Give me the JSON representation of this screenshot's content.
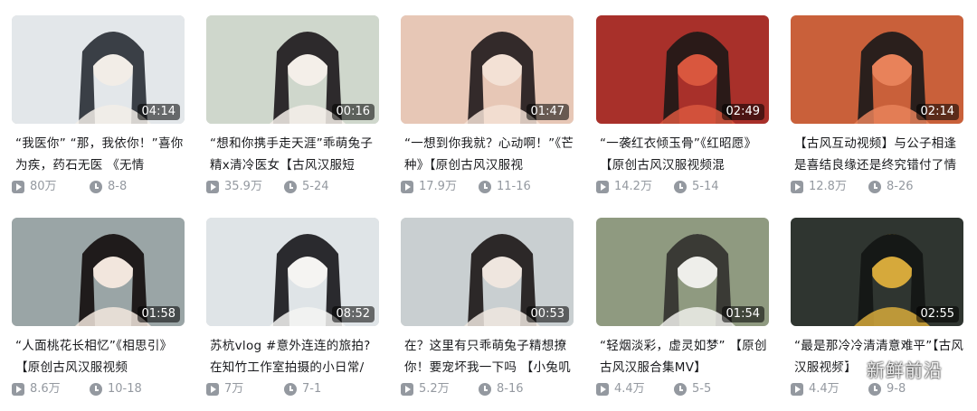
{
  "videos": [
    {
      "title": "“我医你” “那，我依你！”喜你为疾，药石无医 《无情",
      "duration": "04:14",
      "views": "80万",
      "date": "8-8",
      "thumb_colors": [
        "#e3e7ea",
        "#3a3f46",
        "#f2ede7"
      ]
    },
    {
      "title": "“想和你携手走天涯”乖萌兔子精x清冷医女【古风汉服短",
      "duration": "00:16",
      "views": "35.9万",
      "date": "5-24",
      "thumb_colors": [
        "#cfd7cc",
        "#2d2a2c",
        "#f4efe9"
      ]
    },
    {
      "title": "“一想到你我就？心动啊！”《芒种》【原创古风汉服视",
      "duration": "01:47",
      "views": "17.9万",
      "date": "11-16",
      "thumb_colors": [
        "#e7c7b6",
        "#332a2a",
        "#f3e1d5"
      ]
    },
    {
      "title": "“一袭红衣倾玉骨”《红昭愿》【原创古风汉服视频混",
      "duration": "02:49",
      "views": "14.2万",
      "date": "5-14",
      "thumb_colors": [
        "#a8302a",
        "#2a1a18",
        "#d9573e"
      ]
    },
    {
      "title": "【古风互动视频】与公子相逢是喜结良缘还是终究错付了情",
      "duration": "02:14",
      "views": "12.8万",
      "date": "8-26",
      "thumb_colors": [
        "#c9603a",
        "#2a1f1c",
        "#e8825a"
      ]
    },
    {
      "title": "“人面桃花长相忆”《相思引》【原创古风汉服视频",
      "duration": "01:58",
      "views": "8.6万",
      "date": "10-18",
      "thumb_colors": [
        "#9aa5a6",
        "#1f1b1b",
        "#f2e6dd"
      ]
    },
    {
      "title": "苏杭vlog #意外连连的旅拍?在知竹工作室拍摄的小日常/",
      "duration": "08:52",
      "views": "7万",
      "date": "7-1",
      "thumb_colors": [
        "#dfe4e7",
        "#2a2a2e",
        "#f5f4f2"
      ]
    },
    {
      "title": "在？这里有只乖萌兔子精想撩你！要宠坏我一下吗 【小兔叽",
      "duration": "00:53",
      "views": "5.2万",
      "date": "8-16",
      "thumb_colors": [
        "#c9cfd1",
        "#2c2828",
        "#efe6df"
      ]
    },
    {
      "title": "“轻烟淡彩，虚灵如梦” 【原创古风汉服合集MV】",
      "duration": "01:54",
      "views": "4.4万",
      "date": "5-5",
      "thumb_colors": [
        "#8f9a80",
        "#3a3a35",
        "#eeeeea"
      ]
    },
    {
      "title": "“最是那冷冷清清意难平”【古风汉服视频】",
      "duration": "02:55",
      "views": "4.4万",
      "date": "9-8",
      "thumb_colors": [
        "#2f3530",
        "#151816",
        "#d6a93b"
      ]
    }
  ],
  "watermark": {
    "text": "新鲜前沿"
  }
}
